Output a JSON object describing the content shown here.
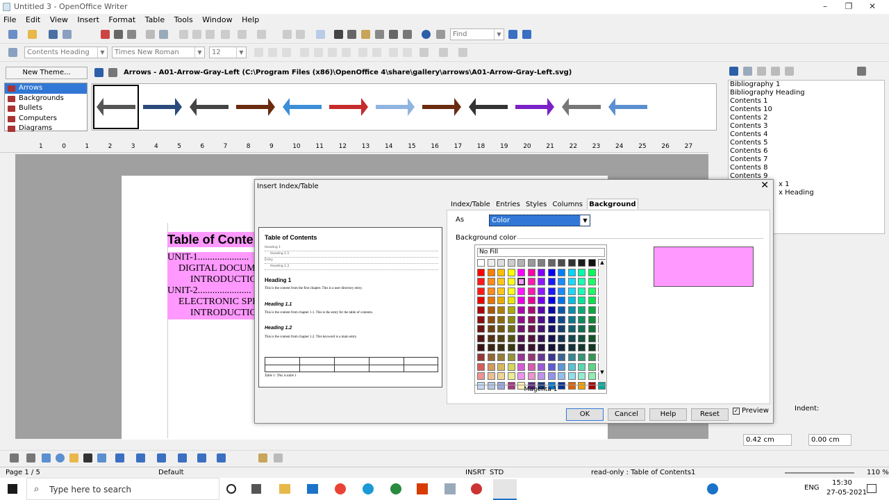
{
  "window": {
    "title": "Untitled 3 - OpenOffice Writer",
    "minimize": "–",
    "maximize": "❐",
    "close": "✕"
  },
  "menu": [
    "File",
    "Edit",
    "View",
    "Insert",
    "Format",
    "Table",
    "Tools",
    "Window",
    "Help"
  ],
  "toolbar": {
    "find_placeholder": "Find",
    "paragraph_style": "Contents Heading",
    "font_name": "Times New Roman",
    "font_size": "12"
  },
  "gallery": {
    "new_theme": "New Theme...",
    "themes": [
      "Arrows",
      "Backgrounds",
      "Bullets",
      "Computers",
      "Diagrams"
    ],
    "selected_theme": "Arrows",
    "path": "Arrows - A01-Arrow-Gray-Left (C:\\Program Files (x86)\\OpenOffice 4\\share\\gallery\\arrows\\A01-Arrow-Gray-Left.svg)",
    "arrow_colors": [
      "#555555",
      "#2a4a7a",
      "#444444",
      "#6b2b0f",
      "#3c8ed8",
      "#c62b2b",
      "#8fb4e0",
      "#6b2b0f",
      "#333333",
      "#7a22c8",
      "#777777",
      "#5b8fd0"
    ]
  },
  "ruler": {
    "numbers": [
      "1",
      "0",
      "1",
      "2",
      "3",
      "4",
      "5",
      "6",
      "7",
      "8",
      "9",
      "10",
      "11",
      "12",
      "13",
      "14",
      "15",
      "16",
      "17",
      "18",
      "19",
      "20",
      "21",
      "22",
      "23",
      "24",
      "25",
      "26",
      "27"
    ]
  },
  "document": {
    "toc_title": "Table of Conte",
    "lines": [
      "UNIT-1.....................",
      "DIGITAL DOCUM",
      "INTRODUCTIO",
      "UNIT-2......................",
      "ELECTRONIC SPI",
      "INTRODUCTIO"
    ]
  },
  "styles_panel": {
    "items": [
      "Bibliography 1",
      "Bibliography Heading",
      "Contents 1",
      "Contents 10",
      "Contents 2",
      "Contents 3",
      "Contents 4",
      "Contents 5",
      "Contents 6",
      "Contents 7",
      "Contents 8",
      "Contents 9",
      "x 1",
      "x Heading"
    ],
    "indent_label": "Indent:",
    "spacing_above": "0.42 cm",
    "spacing_below": "0.00 cm"
  },
  "dialog": {
    "title": "Insert Index/Table",
    "close": "✕",
    "tabs": [
      "Index/Table",
      "Entries",
      "Styles",
      "Columns",
      "Background"
    ],
    "active_tab": "Background",
    "as_label": "As",
    "as_value": "Color",
    "bg_color_label": "Background color",
    "no_fill": "No Fill",
    "selected_color_name": "Magenta 1",
    "selected_color": "#ff99ff",
    "buttons": {
      "ok": "OK",
      "cancel": "Cancel",
      "help": "Help",
      "reset": "Reset"
    },
    "preview_label": "Preview",
    "preview": {
      "title": "Table of Contents",
      "toc": [
        "Heading 1",
        "Heading 1.1",
        "Entry",
        "Heading 1.2"
      ],
      "h1": "Heading 1",
      "p1": "This is the content from the first chapter. This is a user directory entry.",
      "h11": "Heading 1.1",
      "p11": "This is the content from chapter 1.1. This is the entry for the table of contents.",
      "h12": "Heading 1.2",
      "p12": "This is the content from chapter 1.2. This keyword is a main entry.",
      "caption": "Table 1: This is table 1"
    }
  },
  "statusbar": {
    "page": "Page 1 / 5",
    "style": "Default",
    "mode": "INSRT",
    "sel": "STD",
    "readonly": "read-only : Table of Contents1",
    "zoom": "110 %"
  },
  "taskbar": {
    "search": "Type here to search",
    "lang": "ENG",
    "time": "15:30",
    "date": "27-05-2021"
  }
}
